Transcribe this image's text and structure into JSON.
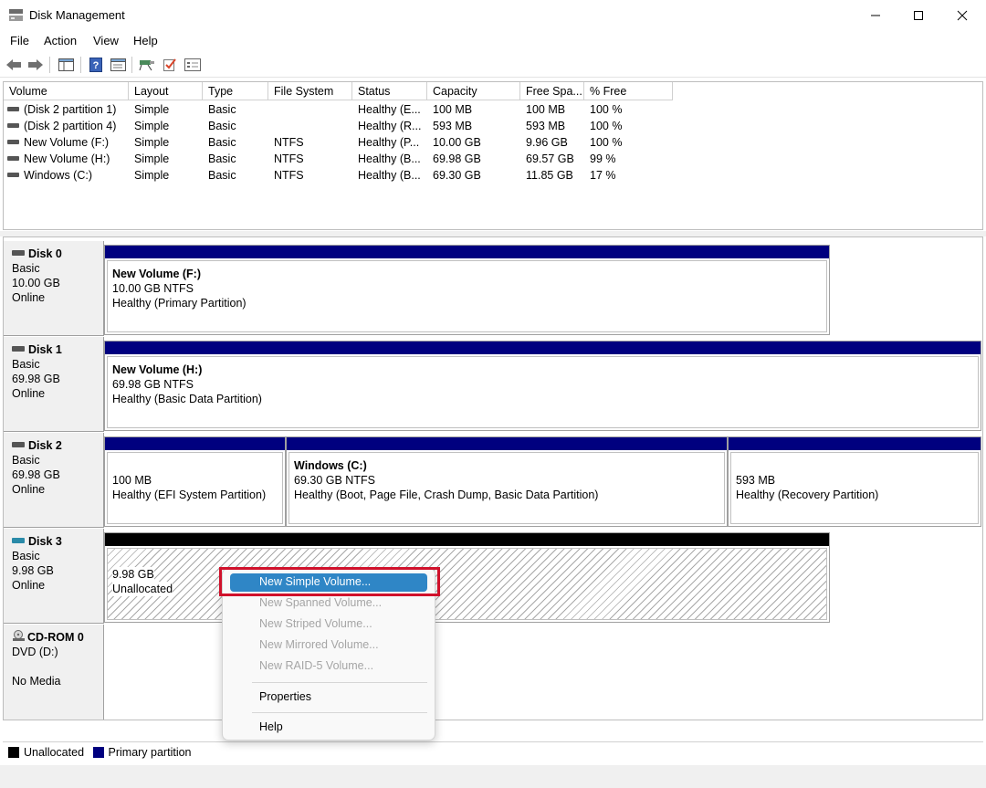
{
  "window": {
    "title": "Disk Management",
    "app_icon": "disk-management-icon"
  },
  "menu": [
    "File",
    "Action",
    "View",
    "Help"
  ],
  "toolbar": [
    "back-arrow-icon",
    "forward-arrow-icon",
    "show-hide-console-tree-icon",
    "help-icon",
    "properties-icon",
    "connect-icon",
    "check-icon",
    "settings-icon"
  ],
  "volume_table": {
    "columns": [
      "Volume",
      "Layout",
      "Type",
      "File System",
      "Status",
      "Capacity",
      "Free Spa...",
      "% Free"
    ],
    "rows": [
      {
        "volume": "(Disk 2 partition 1)",
        "layout": "Simple",
        "type": "Basic",
        "fs": "",
        "status": "Healthy (E...",
        "capacity": "100 MB",
        "free": "100 MB",
        "pct": "100 %"
      },
      {
        "volume": "(Disk 2 partition 4)",
        "layout": "Simple",
        "type": "Basic",
        "fs": "",
        "status": "Healthy (R...",
        "capacity": "593 MB",
        "free": "593 MB",
        "pct": "100 %"
      },
      {
        "volume": "New Volume (F:)",
        "layout": "Simple",
        "type": "Basic",
        "fs": "NTFS",
        "status": "Healthy (P...",
        "capacity": "10.00 GB",
        "free": "9.96 GB",
        "pct": "100 %"
      },
      {
        "volume": "New Volume (H:)",
        "layout": "Simple",
        "type": "Basic",
        "fs": "NTFS",
        "status": "Healthy (B...",
        "capacity": "69.98 GB",
        "free": "69.57 GB",
        "pct": "99 %"
      },
      {
        "volume": "Windows (C:)",
        "layout": "Simple",
        "type": "Basic",
        "fs": "NTFS",
        "status": "Healthy (B...",
        "capacity": "69.30 GB",
        "free": "11.85 GB",
        "pct": "17 %"
      }
    ]
  },
  "disks": [
    {
      "name": "Disk 0",
      "kind": "Basic",
      "size": "10.00 GB",
      "state": "Online",
      "partitions": [
        {
          "title": "New Volume  (F:)",
          "line1": "10.00 GB NTFS",
          "line2": "Healthy (Primary Partition)"
        }
      ]
    },
    {
      "name": "Disk 1",
      "kind": "Basic",
      "size": "69.98 GB",
      "state": "Online",
      "partitions": [
        {
          "title": "New Volume  (H:)",
          "line1": "69.98 GB NTFS",
          "line2": "Healthy (Basic Data Partition)"
        }
      ]
    },
    {
      "name": "Disk 2",
      "kind": "Basic",
      "size": "69.98 GB",
      "state": "Online",
      "partitions": [
        {
          "title": "",
          "line1": "100 MB",
          "line2": "Healthy (EFI System Partition)"
        },
        {
          "title": "Windows  (C:)",
          "line1": "69.30 GB NTFS",
          "line2": "Healthy (Boot, Page File, Crash Dump, Basic Data Partition)"
        },
        {
          "title": "",
          "line1": "593 MB",
          "line2": "Healthy (Recovery Partition)"
        }
      ]
    },
    {
      "name": "Disk 3",
      "kind": "Basic",
      "size": "9.98 GB",
      "state": "Online",
      "partitions": [
        {
          "title": "",
          "line1": "9.98 GB",
          "line2": "Unallocated"
        }
      ]
    },
    {
      "name": "CD-ROM 0",
      "kind": "DVD (D:)",
      "size": "",
      "state": "No Media",
      "partitions": []
    }
  ],
  "context_menu": {
    "items": [
      {
        "label": "New Simple Volume...",
        "enabled": true,
        "highlighted": true
      },
      {
        "label": "New Spanned Volume...",
        "enabled": false
      },
      {
        "label": "New Striped Volume...",
        "enabled": false
      },
      {
        "label": "New Mirrored Volume...",
        "enabled": false
      },
      {
        "label": "New RAID-5 Volume...",
        "enabled": false
      },
      {
        "label": "Properties",
        "enabled": true
      },
      {
        "label": "Help",
        "enabled": true
      }
    ]
  },
  "legend": [
    {
      "label": "Unallocated",
      "color": "#000000"
    },
    {
      "label": "Primary partition",
      "color": "#00007f"
    }
  ],
  "colors": {
    "primary_partition": "#00007f",
    "unallocated": "#000000",
    "highlight": "#2f86c6",
    "callout": "#d0112b"
  }
}
